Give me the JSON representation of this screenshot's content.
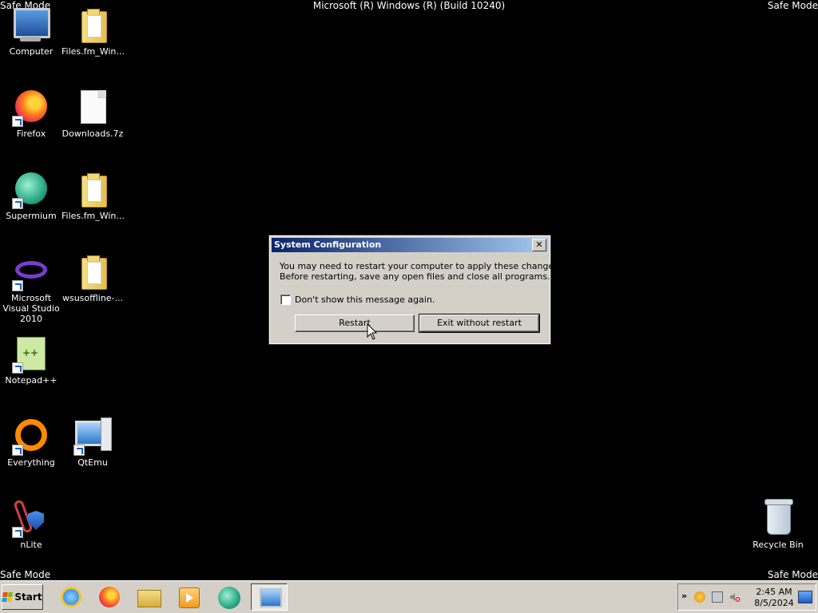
{
  "screen": {
    "safe_mode_label": "Safe Mode",
    "build_text": "Microsoft (R) Windows (R) (Build 10240)"
  },
  "desktop_icons": [
    {
      "label": "Computer",
      "icon": "computer-icon"
    },
    {
      "label": "Files.fm_Win...",
      "icon": "folder-icon"
    },
    {
      "label": "Firefox",
      "icon": "firefox-icon"
    },
    {
      "label": "Downloads.7z",
      "icon": "file-icon"
    },
    {
      "label": "Supermium",
      "icon": "supermium-icon"
    },
    {
      "label": "Files.fm_Win...",
      "icon": "folder-icon"
    },
    {
      "label": "Microsoft Visual Studio 2010",
      "icon": "visual-studio-icon"
    },
    {
      "label": "wsusoffline-...",
      "icon": "folder-icon"
    },
    {
      "label": "Notepad++",
      "icon": "notepad-plus-plus-icon"
    },
    {
      "label": "Everything",
      "icon": "everything-icon"
    },
    {
      "label": "QtEmu",
      "icon": "qtemu-icon"
    },
    {
      "label": "nLite",
      "icon": "nlite-icon"
    },
    {
      "label": "Recycle Bin",
      "icon": "recycle-bin-icon"
    }
  ],
  "dialog": {
    "title": "System Configuration",
    "close_symbol": "✕",
    "message_line1": "You may need to restart your computer to apply these changes.",
    "message_line2": "Before restarting, save any open files and close all programs.",
    "checkbox_label": "Don't show this message again.",
    "checkbox_checked": false,
    "restart_label": "Restart",
    "exit_label": "Exit without restart"
  },
  "taskbar": {
    "start_label": "Start",
    "pinned": [
      "internet-explorer-icon",
      "firefox-icon",
      "file-explorer-icon",
      "media-player-icon",
      "supermium-icon",
      "system-configuration-icon"
    ],
    "tray_chevron": "»",
    "time": "2:45 AM",
    "date": "8/5/2024"
  },
  "colors": {
    "desktop_bg": "#000000",
    "title_bar_start": "#0a246a",
    "title_bar_end": "#a6caf0",
    "taskbar_bg": "#d4d0c8"
  }
}
